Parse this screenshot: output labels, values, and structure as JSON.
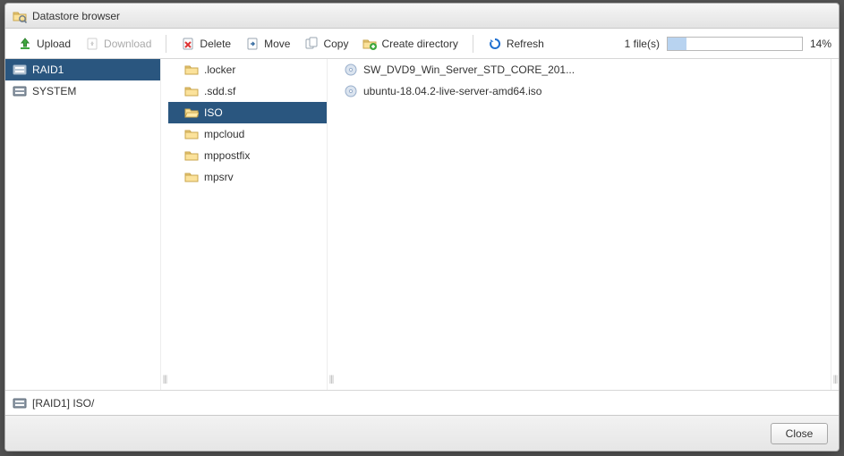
{
  "window": {
    "title": "Datastore browser"
  },
  "toolbar": {
    "upload": "Upload",
    "download": "Download",
    "delete": "Delete",
    "move": "Move",
    "copy": "Copy",
    "create_dir": "Create directory",
    "refresh": "Refresh"
  },
  "status": {
    "file_count_label": "1 file(s)",
    "progress_percent": 14,
    "progress_label": "14%"
  },
  "datastores": [
    {
      "name": "RAID1",
      "selected": true
    },
    {
      "name": "SYSTEM",
      "selected": false
    }
  ],
  "folders": [
    {
      "name": ".locker",
      "selected": false
    },
    {
      "name": ".sdd.sf",
      "selected": false
    },
    {
      "name": "ISO",
      "selected": true
    },
    {
      "name": "mpcloud",
      "selected": false
    },
    {
      "name": "mppostfix",
      "selected": false
    },
    {
      "name": "mpsrv",
      "selected": false
    }
  ],
  "files": [
    {
      "name": "SW_DVD9_Win_Server_STD_CORE_201..."
    },
    {
      "name": "ubuntu-18.04.2-live-server-amd64.iso"
    }
  ],
  "path": "[RAID1] ISO/",
  "footer": {
    "close": "Close"
  }
}
